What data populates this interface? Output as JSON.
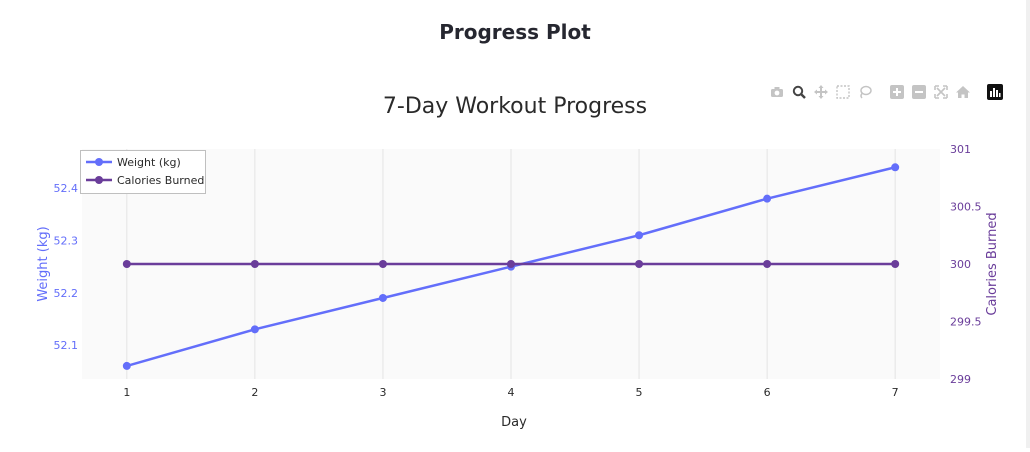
{
  "page": {
    "heading": "Progress Plot"
  },
  "modebar": {
    "buttons": [
      {
        "name": "camera-icon",
        "title": "Download plot as a png"
      },
      {
        "name": "zoom-icon",
        "title": "Zoom"
      },
      {
        "name": "pan-icon",
        "title": "Pan"
      },
      {
        "name": "box-select-icon",
        "title": "Box Select"
      },
      {
        "name": "lasso-select-icon",
        "title": "Lasso Select"
      },
      {
        "name": "zoom-in-icon",
        "title": "Zoom in"
      },
      {
        "name": "zoom-out-icon",
        "title": "Zoom out"
      },
      {
        "name": "autoscale-icon",
        "title": "Autoscale"
      },
      {
        "name": "reset-axes-icon",
        "title": "Reset axes"
      },
      {
        "name": "plotly-logo-icon",
        "title": "Produced with Plotly"
      }
    ]
  },
  "chart_data": {
    "type": "line",
    "title": "7-Day Workout Progress",
    "xlabel": "Day",
    "ylabel": "Weight (kg)",
    "y2label": "Calories Burned",
    "x": [
      1,
      2,
      3,
      4,
      5,
      6,
      7
    ],
    "xlim": [
      0.65,
      7.35
    ],
    "ylim": [
      52.035,
      52.475
    ],
    "y2lim": [
      299,
      301
    ],
    "yticks": [
      52.1,
      52.2,
      52.3,
      52.4
    ],
    "y2ticks": [
      299,
      299.5,
      300,
      300.5,
      301
    ],
    "y2tick_labels": [
      "299",
      "299.5",
      "300",
      "300.5",
      "301"
    ],
    "grid": true,
    "legend_position": "top-left",
    "series": [
      {
        "name": "Weight (kg)",
        "axis": "y",
        "color": "#636efa",
        "values": [
          52.06,
          52.13,
          52.19,
          52.25,
          52.31,
          52.38,
          52.44
        ]
      },
      {
        "name": "Calories Burned",
        "axis": "y2",
        "color": "#6a3d9a",
        "values": [
          300,
          300,
          300,
          300,
          300,
          300,
          300
        ]
      }
    ]
  }
}
